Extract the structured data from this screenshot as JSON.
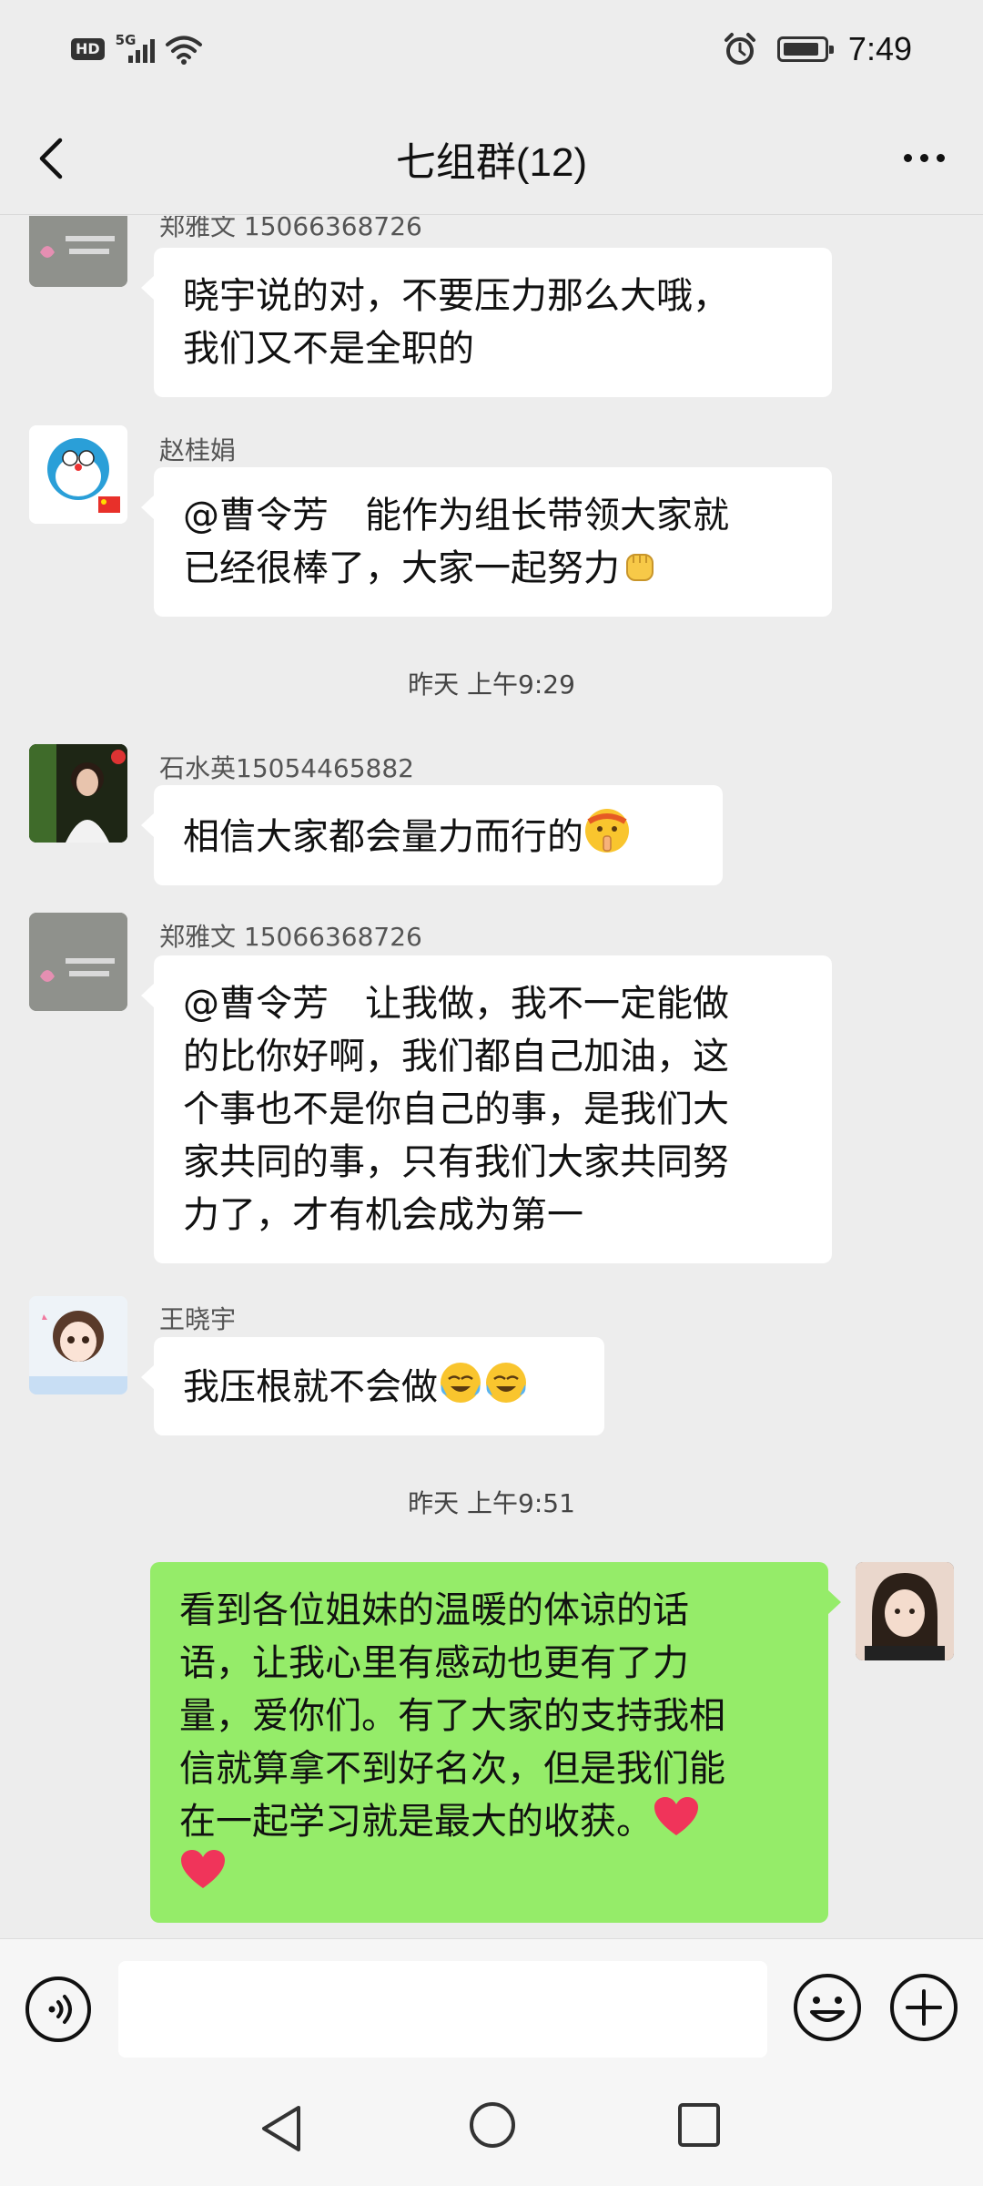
{
  "status_bar": {
    "hd_label": "HD",
    "network_label": "5G",
    "time": "7:49"
  },
  "header": {
    "title": "七组群(12)"
  },
  "messages": [
    {
      "sender": "郑雅文 15066368726",
      "lines": [
        "晓宇说的对，不要压力那么大哦，",
        "我们又不是全职的"
      ]
    },
    {
      "sender": "赵桂娟",
      "lines": [
        "@曹令芳　能作为组长带领大家就",
        "已经很棒了，大家一起努力"
      ],
      "emoji": "fist-icon"
    },
    {
      "timestamp": "昨天 上午9:29"
    },
    {
      "sender": "石水英15054465882",
      "lines": [
        "相信大家都会量力而行的"
      ],
      "emoji": "shushing-face-icon"
    },
    {
      "sender": "郑雅文 15066368726",
      "lines": [
        "@曹令芳　让我做，我不一定能做",
        "的比你好啊，我们都自己加油，这",
        "个事也不是你自己的事，是我们大",
        "家共同的事，只有我们大家共同努",
        "力了，才有机会成为第一"
      ]
    },
    {
      "sender": "王晓宇",
      "lines": [
        "我压根就不会做"
      ],
      "emoji": "crying-laughing-icon"
    },
    {
      "timestamp": "昨天 上午9:51"
    },
    {
      "sender": "",
      "mine": true,
      "lines": [
        "看到各位姐妹的温暖的体谅的话",
        "语，让我心里有感动也更有了力",
        "量，爱你们。有了大家的支持我相",
        "信就算拿不到好名次，但是我们能",
        "在一起学习就是最大的收获。"
      ],
      "emoji": "heart-icon"
    }
  ],
  "colors": {
    "background": "#ededed",
    "bubble_other": "#ffffff",
    "bubble_mine": "#95ec69",
    "heart": "#f0345a"
  }
}
